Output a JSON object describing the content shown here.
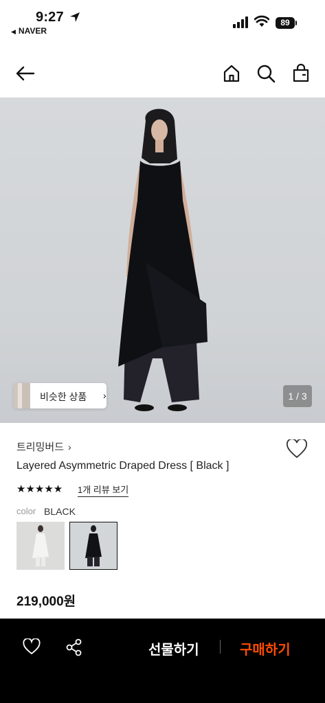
{
  "status": {
    "time": "9:27",
    "back_app": "NAVER",
    "battery": "89"
  },
  "icons": {
    "back": "arrow-left-icon",
    "home": "home-icon",
    "search": "search-icon",
    "bag": "shopping-bag-icon",
    "wish": "heart-icon",
    "share": "share-icon"
  },
  "gallery": {
    "similar_label": "비슷한 상품",
    "pager": "1 / 3"
  },
  "product": {
    "brand": "트리밍버드",
    "brand_arrow": "›",
    "name": "Layered Asymmetric Draped Dress [ Black ]",
    "stars": "★★★★★",
    "rating": 5,
    "review_link": "1개 리뷰 보기",
    "color_label": "color",
    "color_value": "BLACK",
    "swatches": [
      "white",
      "black"
    ],
    "price": "219,000원"
  },
  "bottom_bar": {
    "gift_label": "선물하기",
    "buy_label": "구매하기",
    "buy_color": "#ff4d00"
  }
}
